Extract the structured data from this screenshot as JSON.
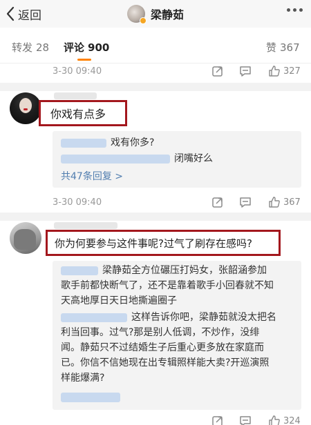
{
  "header": {
    "back_label": "返回",
    "title": "梁静茹"
  },
  "tabs": [
    {
      "label": "转发",
      "count": "28"
    },
    {
      "label": "评论",
      "count": "900"
    },
    {
      "label": "赞",
      "count": "367"
    }
  ],
  "top_meta": {
    "time": "3-30 09:40",
    "likes": "327"
  },
  "comment1": {
    "text": "你戏有点多",
    "replies": [
      "戏有你多?",
      "闭嘴好么"
    ],
    "view_more": "共47条回复 >",
    "time": "3-30 09:40",
    "likes": "367"
  },
  "comment2": {
    "text": "你为何要参与这件事呢?过气了刷存在感吗?",
    "reply1_lines": [
      "梁静茹全方位碾压打妈女，张韶涵参加",
      "歌手前都快断气了，还不是靠着歌手小回春就不知",
      "天高地厚日天日地撕遍圈子"
    ],
    "reply2_lines": [
      "这样告诉你吧，梁静茹就没太把名",
      "利当回事。过气?那是别人低调，不炒作，没绯",
      "闻。静茹只不过结婚生子后重心更多放在家庭而",
      "已。你信不信她现在出专辑照样能大卖?开巡演照",
      "样能爆满?"
    ],
    "likes": "324"
  },
  "colors": {
    "accent": "#ff8200",
    "highlight_box": "#a3171d",
    "link": "#507daf"
  }
}
